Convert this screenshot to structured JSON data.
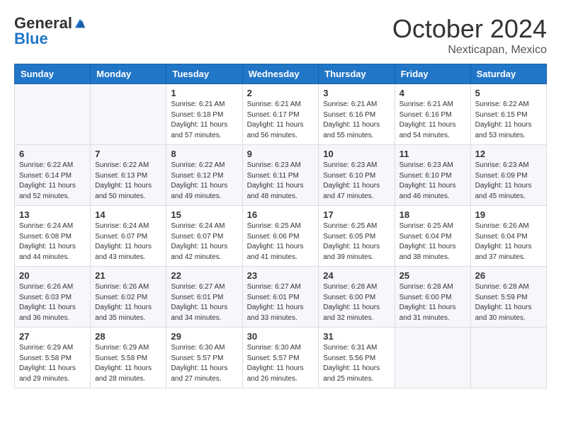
{
  "header": {
    "logo": {
      "general": "General",
      "blue": "Blue"
    },
    "title": "October 2024",
    "location": "Nexticapan, Mexico"
  },
  "weekdays": [
    "Sunday",
    "Monday",
    "Tuesday",
    "Wednesday",
    "Thursday",
    "Friday",
    "Saturday"
  ],
  "weeks": [
    [
      {
        "day": "",
        "sunrise": "",
        "sunset": "",
        "daylight": ""
      },
      {
        "day": "",
        "sunrise": "",
        "sunset": "",
        "daylight": ""
      },
      {
        "day": "1",
        "sunrise": "Sunrise: 6:21 AM",
        "sunset": "Sunset: 6:18 PM",
        "daylight": "Daylight: 11 hours and 57 minutes."
      },
      {
        "day": "2",
        "sunrise": "Sunrise: 6:21 AM",
        "sunset": "Sunset: 6:17 PM",
        "daylight": "Daylight: 11 hours and 56 minutes."
      },
      {
        "day": "3",
        "sunrise": "Sunrise: 6:21 AM",
        "sunset": "Sunset: 6:16 PM",
        "daylight": "Daylight: 11 hours and 55 minutes."
      },
      {
        "day": "4",
        "sunrise": "Sunrise: 6:21 AM",
        "sunset": "Sunset: 6:16 PM",
        "daylight": "Daylight: 11 hours and 54 minutes."
      },
      {
        "day": "5",
        "sunrise": "Sunrise: 6:22 AM",
        "sunset": "Sunset: 6:15 PM",
        "daylight": "Daylight: 11 hours and 53 minutes."
      }
    ],
    [
      {
        "day": "6",
        "sunrise": "Sunrise: 6:22 AM",
        "sunset": "Sunset: 6:14 PM",
        "daylight": "Daylight: 11 hours and 52 minutes."
      },
      {
        "day": "7",
        "sunrise": "Sunrise: 6:22 AM",
        "sunset": "Sunset: 6:13 PM",
        "daylight": "Daylight: 11 hours and 50 minutes."
      },
      {
        "day": "8",
        "sunrise": "Sunrise: 6:22 AM",
        "sunset": "Sunset: 6:12 PM",
        "daylight": "Daylight: 11 hours and 49 minutes."
      },
      {
        "day": "9",
        "sunrise": "Sunrise: 6:23 AM",
        "sunset": "Sunset: 6:11 PM",
        "daylight": "Daylight: 11 hours and 48 minutes."
      },
      {
        "day": "10",
        "sunrise": "Sunrise: 6:23 AM",
        "sunset": "Sunset: 6:10 PM",
        "daylight": "Daylight: 11 hours and 47 minutes."
      },
      {
        "day": "11",
        "sunrise": "Sunrise: 6:23 AM",
        "sunset": "Sunset: 6:10 PM",
        "daylight": "Daylight: 11 hours and 46 minutes."
      },
      {
        "day": "12",
        "sunrise": "Sunrise: 6:23 AM",
        "sunset": "Sunset: 6:09 PM",
        "daylight": "Daylight: 11 hours and 45 minutes."
      }
    ],
    [
      {
        "day": "13",
        "sunrise": "Sunrise: 6:24 AM",
        "sunset": "Sunset: 6:08 PM",
        "daylight": "Daylight: 11 hours and 44 minutes."
      },
      {
        "day": "14",
        "sunrise": "Sunrise: 6:24 AM",
        "sunset": "Sunset: 6:07 PM",
        "daylight": "Daylight: 11 hours and 43 minutes."
      },
      {
        "day": "15",
        "sunrise": "Sunrise: 6:24 AM",
        "sunset": "Sunset: 6:07 PM",
        "daylight": "Daylight: 11 hours and 42 minutes."
      },
      {
        "day": "16",
        "sunrise": "Sunrise: 6:25 AM",
        "sunset": "Sunset: 6:06 PM",
        "daylight": "Daylight: 11 hours and 41 minutes."
      },
      {
        "day": "17",
        "sunrise": "Sunrise: 6:25 AM",
        "sunset": "Sunset: 6:05 PM",
        "daylight": "Daylight: 11 hours and 39 minutes."
      },
      {
        "day": "18",
        "sunrise": "Sunrise: 6:25 AM",
        "sunset": "Sunset: 6:04 PM",
        "daylight": "Daylight: 11 hours and 38 minutes."
      },
      {
        "day": "19",
        "sunrise": "Sunrise: 6:26 AM",
        "sunset": "Sunset: 6:04 PM",
        "daylight": "Daylight: 11 hours and 37 minutes."
      }
    ],
    [
      {
        "day": "20",
        "sunrise": "Sunrise: 6:26 AM",
        "sunset": "Sunset: 6:03 PM",
        "daylight": "Daylight: 11 hours and 36 minutes."
      },
      {
        "day": "21",
        "sunrise": "Sunrise: 6:26 AM",
        "sunset": "Sunset: 6:02 PM",
        "daylight": "Daylight: 11 hours and 35 minutes."
      },
      {
        "day": "22",
        "sunrise": "Sunrise: 6:27 AM",
        "sunset": "Sunset: 6:01 PM",
        "daylight": "Daylight: 11 hours and 34 minutes."
      },
      {
        "day": "23",
        "sunrise": "Sunrise: 6:27 AM",
        "sunset": "Sunset: 6:01 PM",
        "daylight": "Daylight: 11 hours and 33 minutes."
      },
      {
        "day": "24",
        "sunrise": "Sunrise: 6:28 AM",
        "sunset": "Sunset: 6:00 PM",
        "daylight": "Daylight: 11 hours and 32 minutes."
      },
      {
        "day": "25",
        "sunrise": "Sunrise: 6:28 AM",
        "sunset": "Sunset: 6:00 PM",
        "daylight": "Daylight: 11 hours and 31 minutes."
      },
      {
        "day": "26",
        "sunrise": "Sunrise: 6:28 AM",
        "sunset": "Sunset: 5:59 PM",
        "daylight": "Daylight: 11 hours and 30 minutes."
      }
    ],
    [
      {
        "day": "27",
        "sunrise": "Sunrise: 6:29 AM",
        "sunset": "Sunset: 5:58 PM",
        "daylight": "Daylight: 11 hours and 29 minutes."
      },
      {
        "day": "28",
        "sunrise": "Sunrise: 6:29 AM",
        "sunset": "Sunset: 5:58 PM",
        "daylight": "Daylight: 11 hours and 28 minutes."
      },
      {
        "day": "29",
        "sunrise": "Sunrise: 6:30 AM",
        "sunset": "Sunset: 5:57 PM",
        "daylight": "Daylight: 11 hours and 27 minutes."
      },
      {
        "day": "30",
        "sunrise": "Sunrise: 6:30 AM",
        "sunset": "Sunset: 5:57 PM",
        "daylight": "Daylight: 11 hours and 26 minutes."
      },
      {
        "day": "31",
        "sunrise": "Sunrise: 6:31 AM",
        "sunset": "Sunset: 5:56 PM",
        "daylight": "Daylight: 11 hours and 25 minutes."
      },
      {
        "day": "",
        "sunrise": "",
        "sunset": "",
        "daylight": ""
      },
      {
        "day": "",
        "sunrise": "",
        "sunset": "",
        "daylight": ""
      }
    ]
  ]
}
